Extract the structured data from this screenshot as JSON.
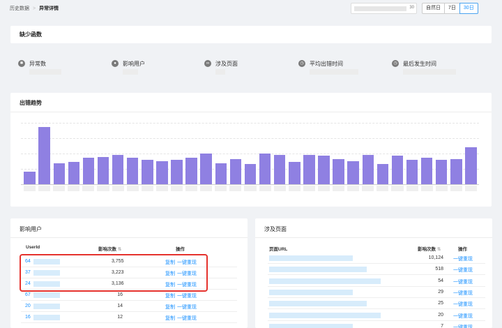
{
  "breadcrumb": {
    "parent": "历史数据",
    "current": "异常详情"
  },
  "date_range": {
    "day_label": "30",
    "options": [
      "自然日",
      "7日",
      "30日"
    ],
    "selected": "30日"
  },
  "missing_card": {
    "title": "缺少函数"
  },
  "stats": [
    {
      "label": "异常数",
      "icon": "bug-icon"
    },
    {
      "label": "影响用户",
      "icon": "user-icon"
    },
    {
      "label": "涉及页面",
      "icon": "link-icon"
    },
    {
      "label": "平均出错时间",
      "icon": "clock-icon"
    },
    {
      "label": "最后发生时间",
      "icon": "clock-icon"
    }
  ],
  "trend": {
    "title": "出错趋势"
  },
  "chart_data": {
    "type": "bar",
    "title": "出错趋势",
    "values": [
      12,
      54,
      20,
      21,
      25,
      26,
      28,
      25,
      23,
      22,
      23,
      25,
      29,
      20,
      24,
      19,
      29,
      28,
      21,
      28,
      27,
      24,
      22,
      28,
      19,
      27,
      23,
      25,
      23,
      24,
      35
    ],
    "ylim": [
      0,
      58
    ],
    "grid": true
  },
  "users_card": {
    "title": "影响用户",
    "columns": {
      "id": "UserId",
      "count": "影响次数",
      "op": "操作"
    },
    "rows": [
      {
        "id": "64",
        "count": "3,755"
      },
      {
        "id": "37",
        "count": "3,223"
      },
      {
        "id": "24",
        "count": "3,136"
      },
      {
        "id": "67",
        "count": "16"
      },
      {
        "id": "20",
        "count": "14"
      },
      {
        "id": "16",
        "count": "12"
      }
    ],
    "copy_label": "复制",
    "replay_label": "一键重现"
  },
  "pages_card": {
    "title": "涉及页面",
    "columns": {
      "url": "页面URL",
      "count": "影响次数",
      "op": "操作"
    },
    "rows": [
      {
        "count": "10,124"
      },
      {
        "count": "518"
      },
      {
        "count": "54"
      },
      {
        "count": "29"
      },
      {
        "count": "25"
      },
      {
        "count": "20"
      },
      {
        "count": "7"
      }
    ],
    "replay_label": "一键重现"
  }
}
